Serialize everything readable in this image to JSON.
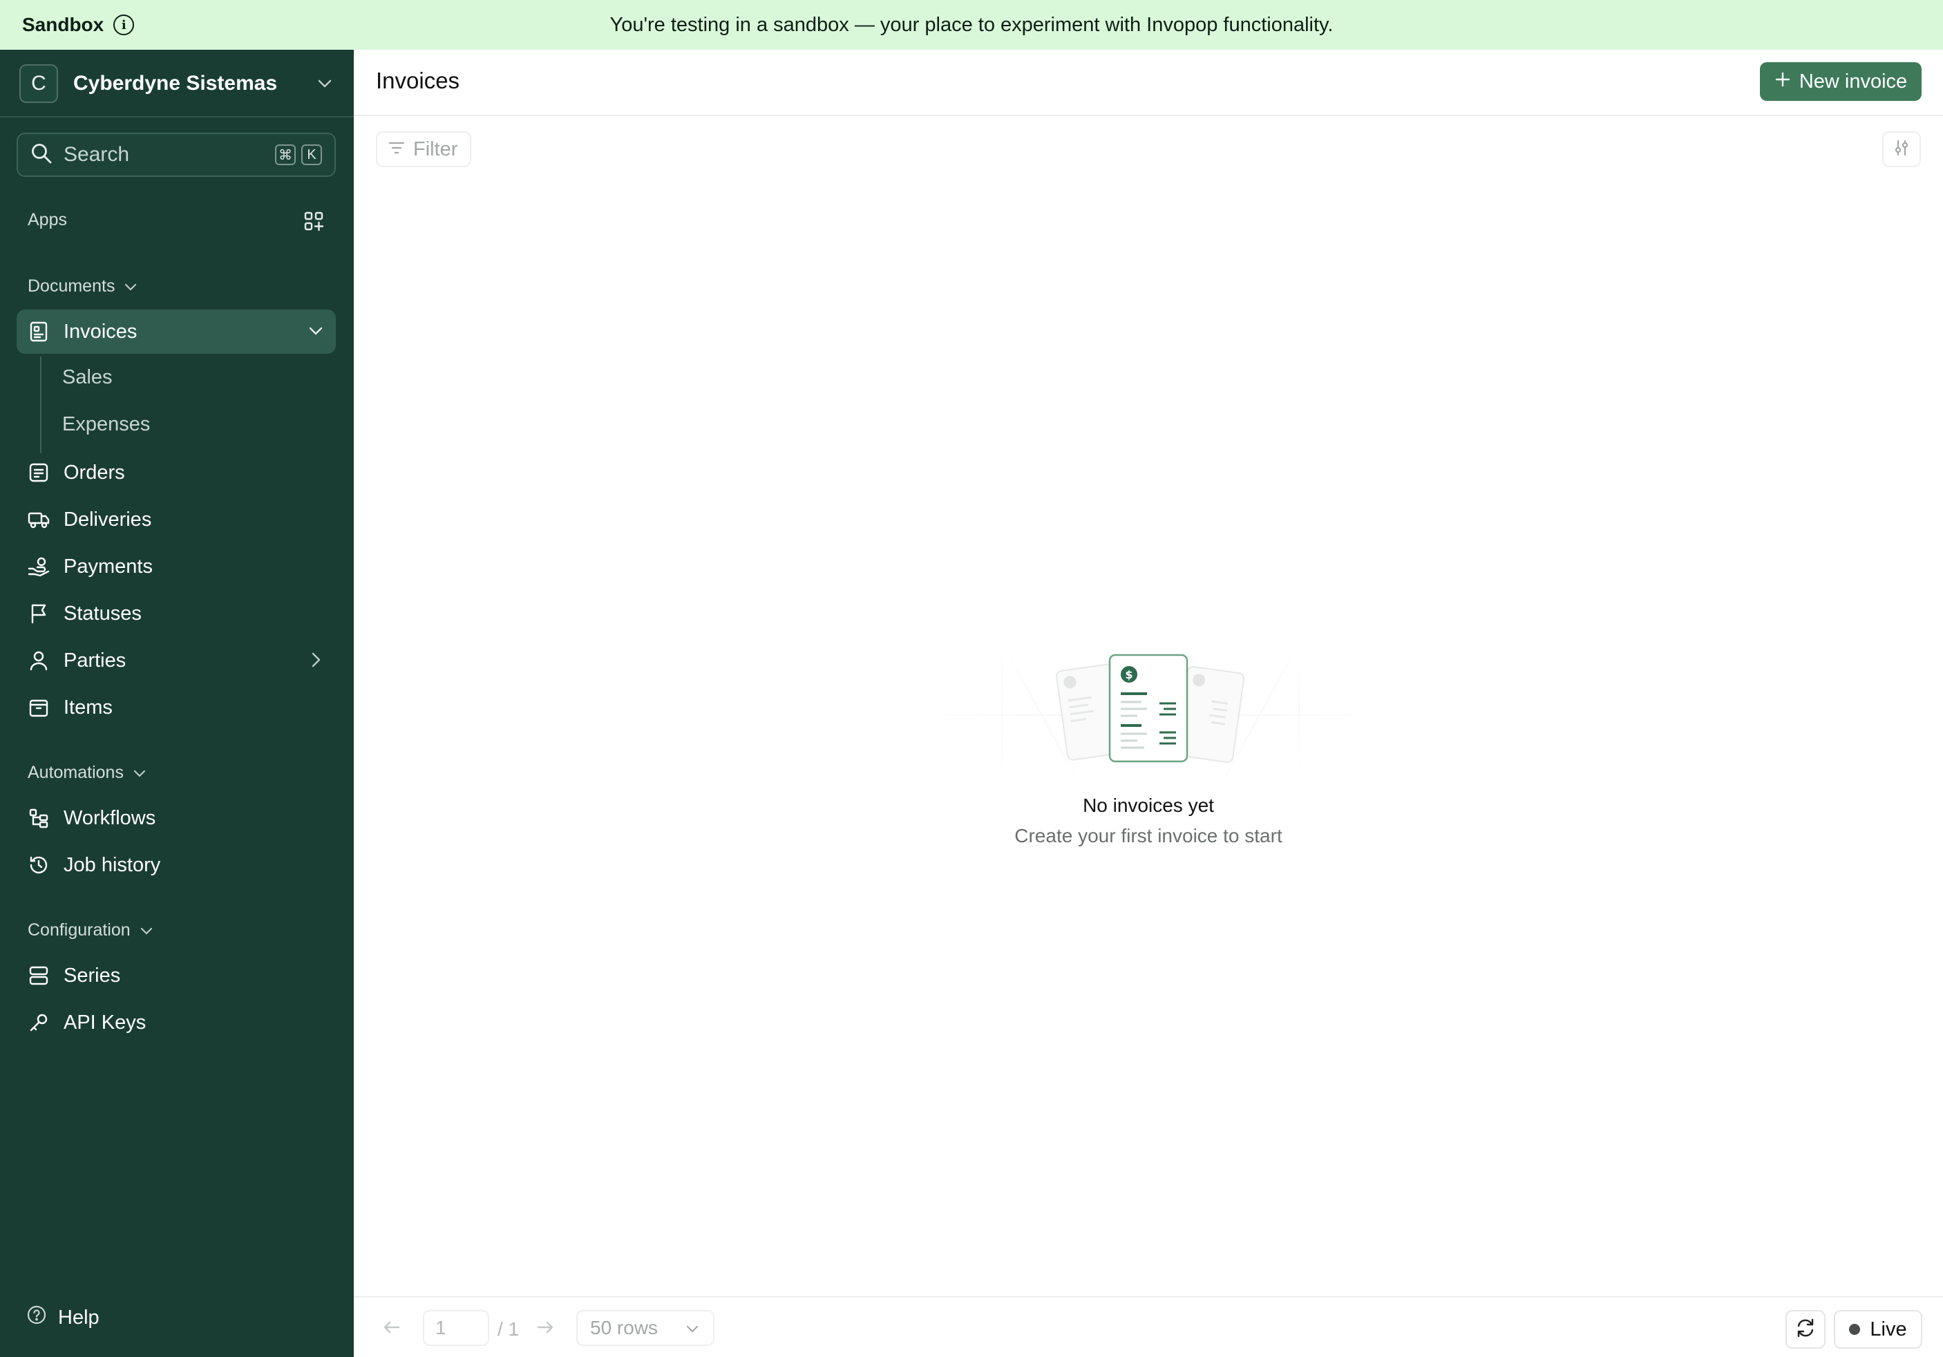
{
  "banner": {
    "env_label": "Sandbox",
    "message": "You're testing in a sandbox — your place to experiment with Invopop functionality.",
    "bg_color": "#d9f8d9"
  },
  "sidebar": {
    "bg_color": "#1a3d33",
    "org": {
      "initial": "C",
      "name": "Cyberdyne Sistemas"
    },
    "search": {
      "label": "Search",
      "shortcut_mod": "⌘",
      "shortcut_key": "K"
    },
    "apps_label": "Apps",
    "sections": {
      "documents": "Documents",
      "automations": "Automations",
      "configuration": "Configuration"
    },
    "items": {
      "invoices": "Invoices",
      "sales": "Sales",
      "expenses": "Expenses",
      "orders": "Orders",
      "deliveries": "Deliveries",
      "payments": "Payments",
      "statuses": "Statuses",
      "parties": "Parties",
      "items": "Items",
      "workflows": "Workflows",
      "job_history": "Job history",
      "series": "Series",
      "api_keys": "API Keys"
    },
    "help_label": "Help"
  },
  "main": {
    "title": "Invoices",
    "new_button_label": "New invoice",
    "accent_color": "#3e7a5a",
    "filter_label": "Filter",
    "empty_state": {
      "title": "No invoices yet",
      "subtitle": "Create your first invoice to start"
    }
  },
  "footer": {
    "page_current": "1",
    "page_total": "/ 1",
    "rows_label": "50 rows",
    "live_label": "Live"
  }
}
